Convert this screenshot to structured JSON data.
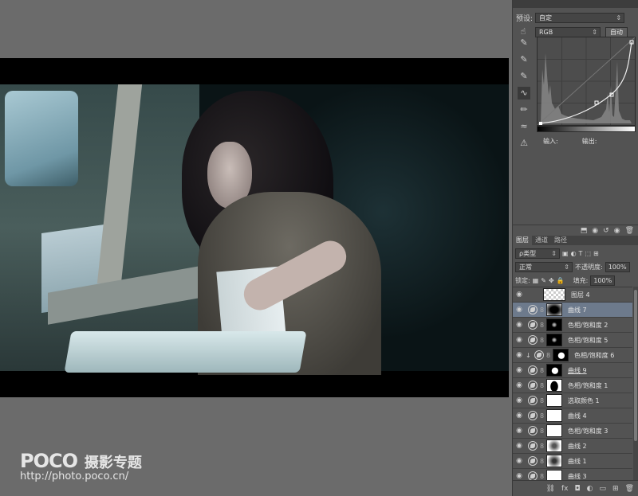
{
  "properties": {
    "preset_label": "预设:",
    "preset_value": "自定",
    "channel_value": "RGB",
    "auto_button": "自动",
    "input_label": "输入:",
    "output_label": "输出:"
  },
  "layers_panel": {
    "tabs": [
      "图层",
      "通道",
      "路径"
    ],
    "filter_value": "ρ类型",
    "blend_mode": "正常",
    "opacity_label": "不透明度:",
    "opacity_value": "100%",
    "lock_label": "锁定:",
    "fill_label": "填充:",
    "fill_value": "100%",
    "layers": [
      {
        "name": "图层 4",
        "type": "pixel",
        "mask": "checker",
        "selected": false
      },
      {
        "name": "曲线 7",
        "type": "adjustment",
        "mask": "dark-vig",
        "selected": true
      },
      {
        "name": "色相/饱和度 2",
        "type": "adjustment",
        "mask": "speck",
        "selected": false
      },
      {
        "name": "色相/饱和度 5",
        "type": "adjustment",
        "mask": "speck",
        "selected": false
      },
      {
        "name": "色相/饱和度 6",
        "type": "adjustment",
        "mask": "blob",
        "selected": false,
        "clipped": true
      },
      {
        "name": "曲线 9",
        "type": "adjustment",
        "mask": "blob",
        "selected": false
      },
      {
        "name": "色相/饱和度 1",
        "type": "adjustment",
        "mask": "person",
        "selected": false
      },
      {
        "name": "选取颜色 1",
        "type": "adjustment",
        "mask": "white",
        "selected": false
      },
      {
        "name": "曲线 4",
        "type": "adjustment",
        "mask": "white",
        "selected": false
      },
      {
        "name": "色相/饱和度 3",
        "type": "adjustment",
        "mask": "white",
        "selected": false
      },
      {
        "name": "曲线 2",
        "type": "adjustment",
        "mask": "fade",
        "selected": false
      },
      {
        "name": "曲线 1",
        "type": "adjustment",
        "mask": "light",
        "selected": false
      },
      {
        "name": "曲线 3",
        "type": "adjustment",
        "mask": "white",
        "selected": false
      }
    ]
  },
  "watermark": {
    "logo": "POCO",
    "subtitle": "摄影专题",
    "url": "http://photo.poco.cn/"
  }
}
